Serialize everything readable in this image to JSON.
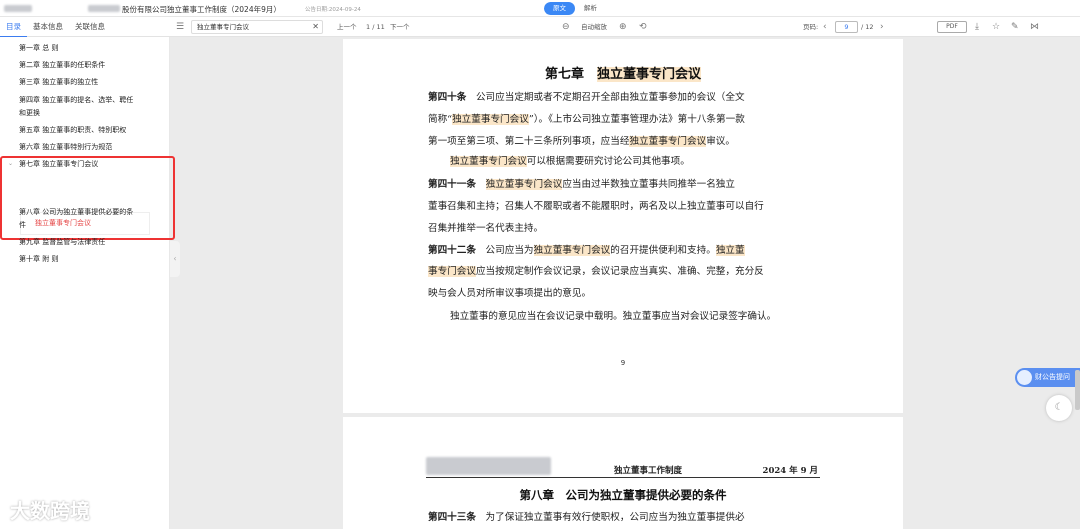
{
  "header": {
    "doc_title": "股份有限公司独立董事工作制度（2024年9月）",
    "date_label": "公告日期:2024-09-24",
    "view_tabs": [
      "原文",
      "解析"
    ]
  },
  "toolbar": {
    "tabs": [
      "目录",
      "基本信息",
      "关联信息"
    ],
    "search_value": "独立董事专门会议",
    "prev_label": "上一个",
    "match_count": "1 / 11",
    "next_label": "下一个",
    "auto_zoom": "自动缩放",
    "page_label": "页码:",
    "page_current": "9",
    "page_total": "/ 12",
    "pdf_label": "PDF"
  },
  "sidebar": {
    "items": [
      "第一章 总 则",
      "第二章 独立董事的任职条件",
      "第三章 独立董事的独立性",
      "第四章 独立董事的提名、选举、聘任",
      "和更换",
      "第五章 独立董事的职责、特别职权",
      "第六章 独立董事特别行为规范",
      "第七章 独立董事专门会议",
      "第八章 公司为独立董事提供必要的条",
      "件",
      "第九章 监督监管与法律责任",
      "第十章 附 则"
    ],
    "sub_item": "独立董事专门会议"
  },
  "page1": {
    "chapter_prefix": "第七章",
    "chapter_title": "独立董事专门会议",
    "lines": [
      [
        "第四十条",
        "　公司应当定期或者不定期召开全部由独立董事参加的会议（全文"
      ],
      [
        "",
        "简称“",
        "独立董事专门会议",
        "”）。《上市公司独立董事管理办法》第十八条第一款"
      ],
      [
        "",
        "第一项至第三项、第二十三条所列事项，应当经",
        "独立董事专门会议",
        "审议。"
      ],
      [
        "",
        "独立董事专门会议",
        "可以根据需要研究讨论公司其他事项。"
      ],
      [
        "第四十一条",
        "　",
        "独立董事专门会议",
        "应当由过半数独立董事共同推举一名独立"
      ],
      [
        "",
        "董事召集和主持；召集人不履职或者不能履职时，两名及以上独立董事可以自行"
      ],
      [
        "",
        "召集并推举一名代表主持。"
      ],
      [
        "第四十二条",
        "　公司应当为",
        "独立董事专门会议",
        "的召开提供便利和支持。",
        "独立董"
      ],
      [
        "",
        "事专门会议",
        "应当按规定制作会议记录，会议记录应当真实、准确、完整，充分反"
      ],
      [
        "",
        "映与会人员对所审议事项提出的意见。"
      ],
      [
        "",
        "独立董事的意见应当在会议记录中载明。独立董事应当对会议记录签字确认。"
      ]
    ],
    "page_number": "9"
  },
  "page2": {
    "header_title": "独立董事工作制度",
    "header_date": "2024 年 9 月",
    "chapter": "第八章　公司为独立董事提供必要的条件",
    "first_line_art": "第四十三条",
    "first_line_text": "　为了保证独立董事有效行使职权，公司应当为独立董事提供必"
  },
  "float": {
    "assistant_label": "财公告提问"
  },
  "watermark": "大数跨境"
}
